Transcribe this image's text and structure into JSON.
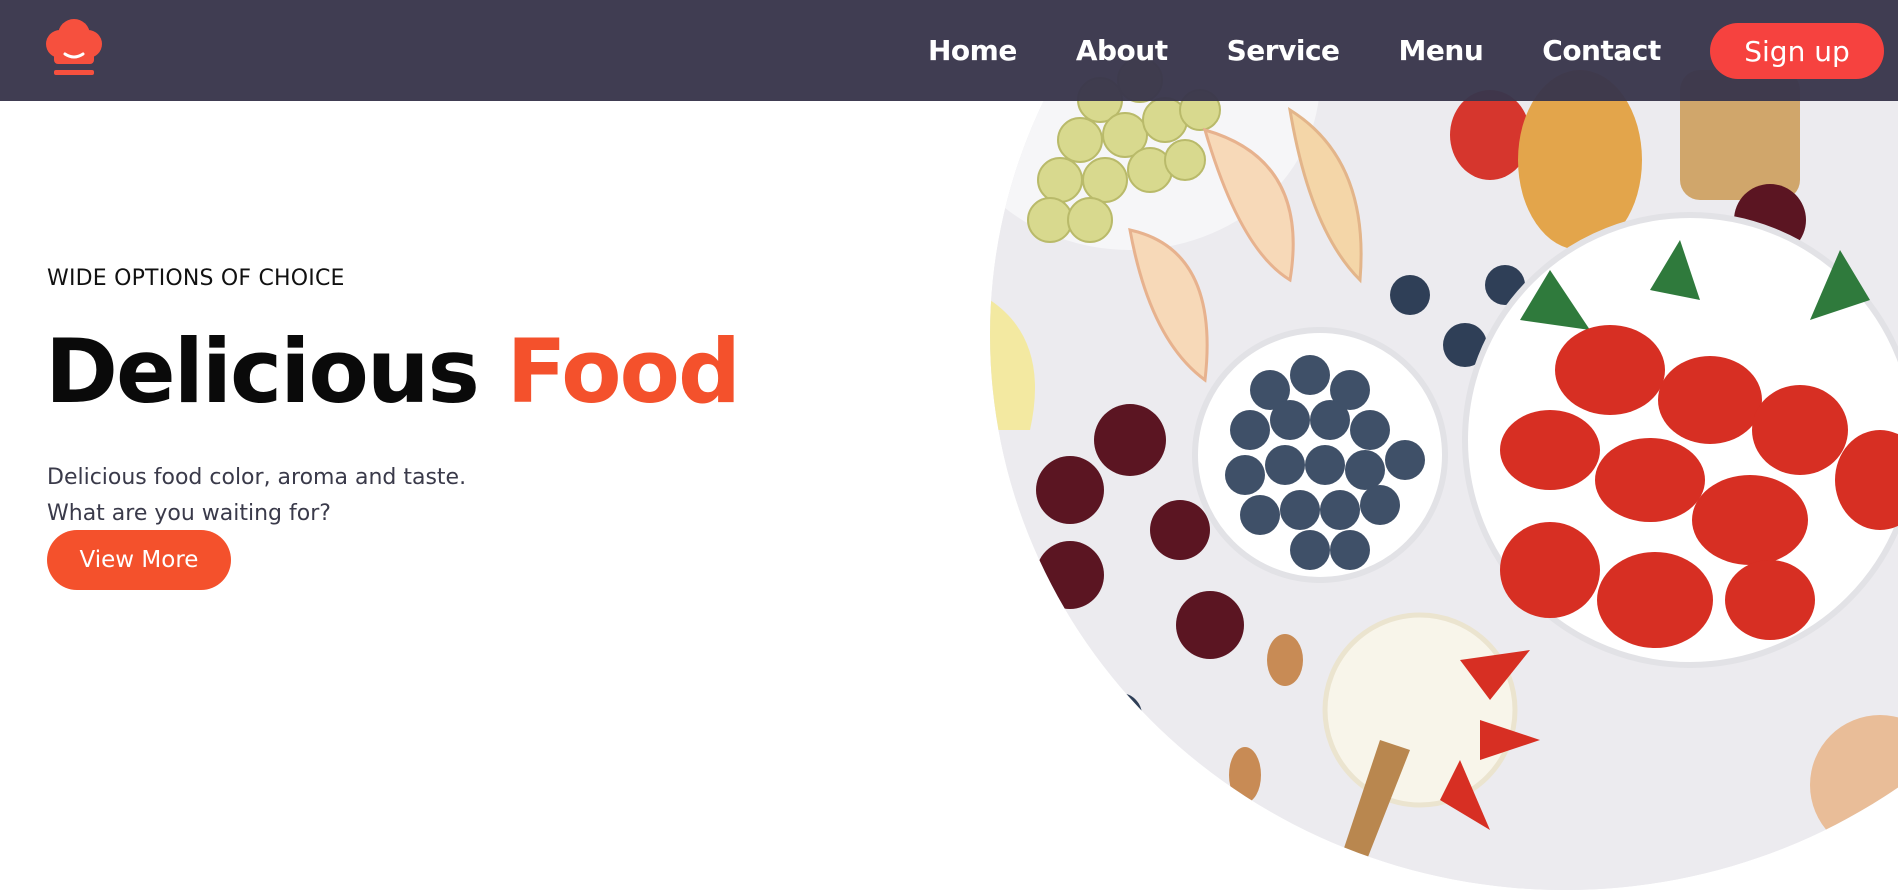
{
  "nav": {
    "logo_icon": "chef-hat-icon",
    "links": [
      {
        "label": "Home"
      },
      {
        "label": "About"
      },
      {
        "label": "Service"
      },
      {
        "label": "Menu"
      },
      {
        "label": "Contact"
      }
    ],
    "signup_label": "Sign up"
  },
  "hero": {
    "eyebrow": "WIDE OPTIONS OF CHOICE",
    "headline_main": "Delicious",
    "headline_accent": "Food",
    "tagline_line1": "Delicious food color, aroma and taste.",
    "tagline_line2": "What are you waiting for?",
    "cta_label": "View More",
    "image_icon": "food-photo-icon"
  },
  "colors": {
    "navbar_bg": "#3a374c",
    "accent": "#f4512c",
    "signup_bg": "#f6423f",
    "text_dark": "#0a0a0a",
    "text_body": "#3a3a4a"
  }
}
